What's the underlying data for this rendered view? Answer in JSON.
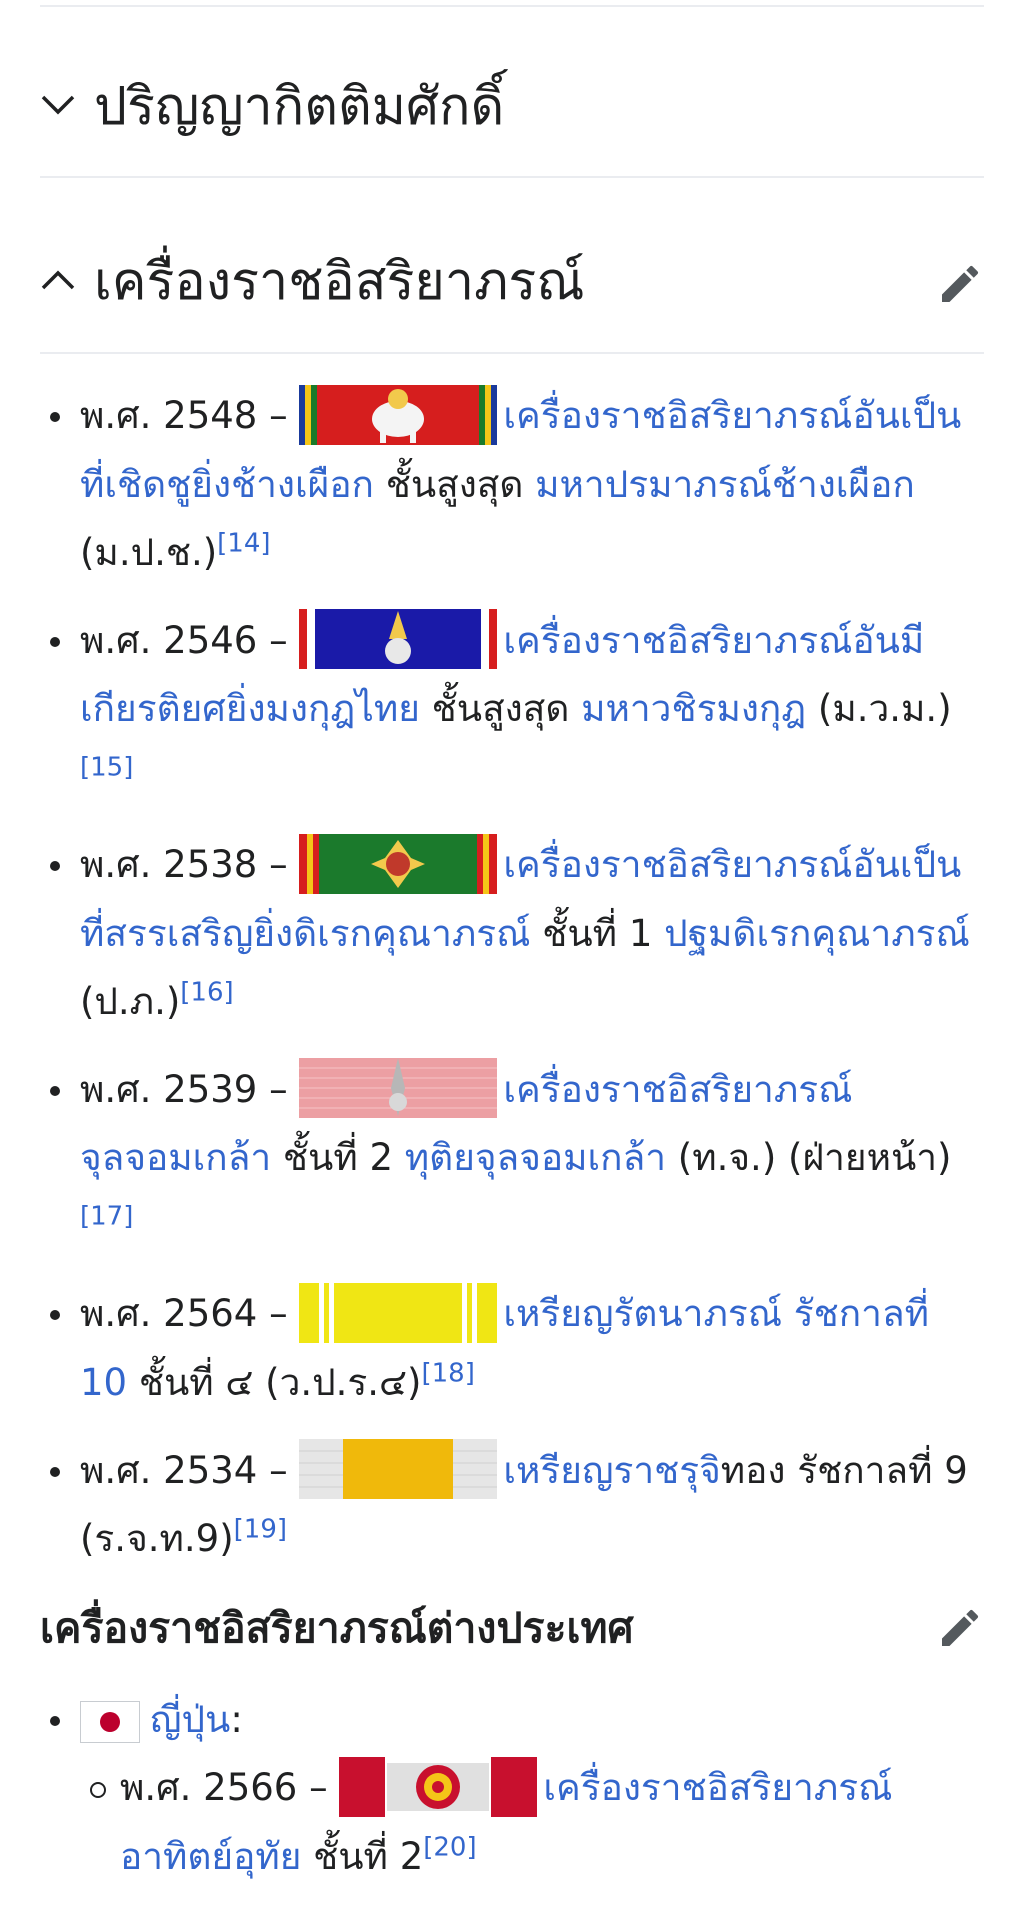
{
  "sections": {
    "honorary": {
      "title": "ปริญญากิตติมศักดิ์"
    },
    "decorations": {
      "title": "เครื่องราชอิสริยาภรณ์"
    }
  },
  "awards": [
    {
      "year": "พ.ศ. 2548",
      "link1": "เครื่องราชอิสริยาภรณ์อันเป็นที่เชิดชูยิ่งช้างเผือก",
      "mid": " ชั้นสูงสุด ",
      "link2": "มหาปรมาภรณ์ช้างเผือก",
      "tail": " (ม.ป.ช.)",
      "ref": "[14]"
    },
    {
      "year": "พ.ศ. 2546",
      "link1": "เครื่องราชอิสริยาภรณ์อันมีเกียรติยศยิ่งมงกุฎไทย",
      "mid": " ชั้นสูงสุด ",
      "link2": "มหาวชิรมงกุฎ",
      "tail": " (ม.ว.ม.)",
      "ref": "[15]"
    },
    {
      "year": "พ.ศ. 2538",
      "link1": "เครื่องราชอิสริยาภรณ์อันเป็นที่สรรเสริญยิ่งดิเรกคุณาภรณ์",
      "mid": " ชั้นที่ 1 ",
      "link2": "ปฐมดิเรกคุณาภรณ์",
      "tail": " (ป.ภ.)",
      "ref": "[16]"
    },
    {
      "year": "พ.ศ. 2539",
      "link1": "เครื่องราชอิสริยาภรณ์จุลจอมเกล้า",
      "mid": " ชั้นที่ 2 ",
      "link2": "ทุติยจุลจอมเกล้า",
      "tail": " (ท.จ.) (ฝ่ายหน้า)",
      "ref": "[17]"
    },
    {
      "year": "พ.ศ. 2564",
      "link1": "เหรียญรัตนาภรณ์ รัชกาลที่ 10",
      "mid": " ชั้นที่ ๔ (ว.ป.ร.๔)",
      "link2": "",
      "tail": "",
      "ref": "[18]"
    },
    {
      "year": "พ.ศ. 2534",
      "link1": "เหรียญราชรุจิ",
      "mid": "ทอง รัชกาลที่ 9 (ร.จ.ท.9)",
      "link2": "",
      "tail": "",
      "ref": "[19]"
    }
  ],
  "foreign": {
    "title": "เครื่องราชอิสริยาภรณ์ต่างประเทศ",
    "country": "ญี่ปุ่น",
    "country_suffix": ":",
    "item": {
      "year": "พ.ศ. 2566",
      "link1": "เครื่องราชอิสริยาภรณ์อาทิตย์อุทัย",
      "mid": " ชั้นที่ 2",
      "ref": "[20]"
    }
  },
  "dash": " – "
}
